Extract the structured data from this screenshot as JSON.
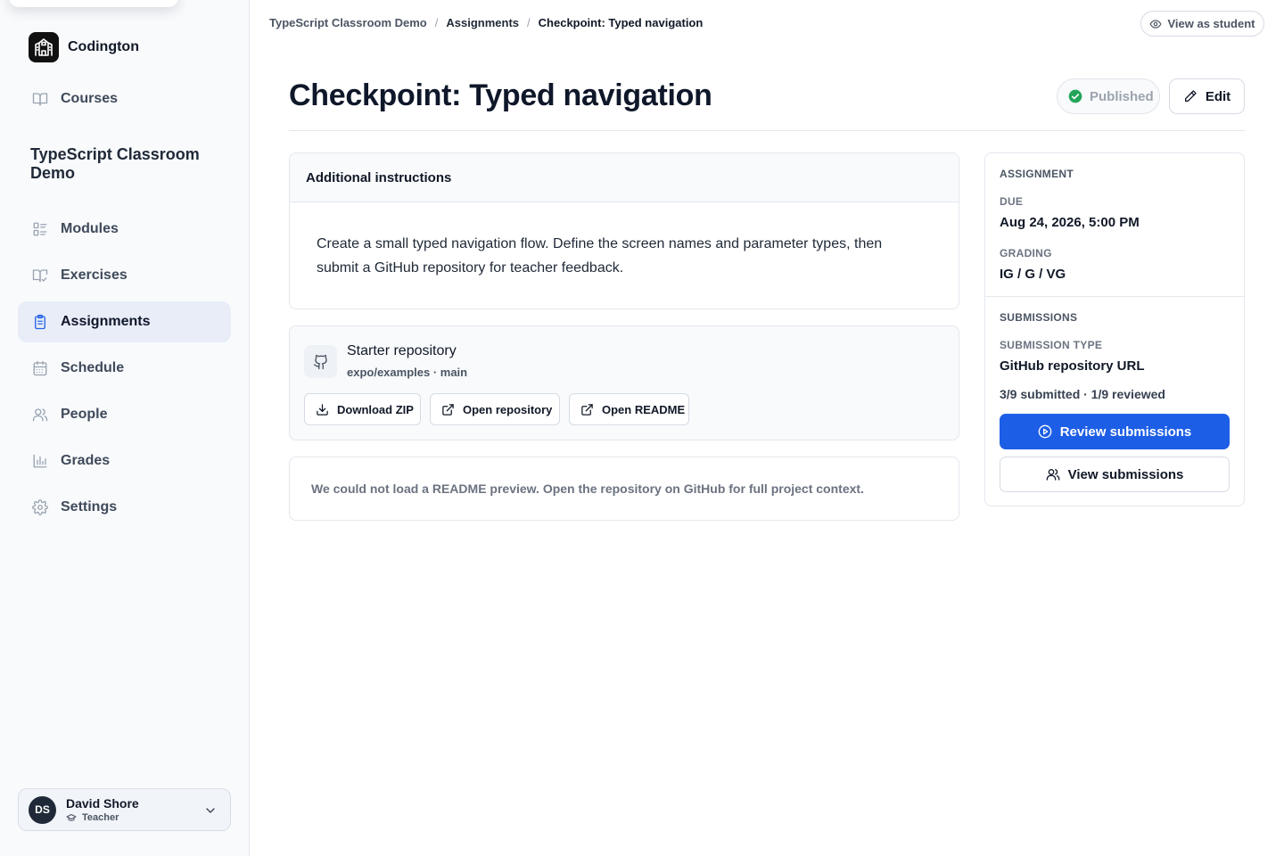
{
  "app": {
    "name": "Codington"
  },
  "sidebar": {
    "top_nav": {
      "label": "Courses",
      "icon": "book-open-icon"
    },
    "course_title": "TypeScript Classroom Demo",
    "items": [
      {
        "label": "Modules",
        "icon": "list-icon",
        "active": false
      },
      {
        "label": "Exercises",
        "icon": "book-check-icon",
        "active": false
      },
      {
        "label": "Assignments",
        "icon": "clipboard-icon",
        "active": true
      },
      {
        "label": "Schedule",
        "icon": "calendar-icon",
        "active": false
      },
      {
        "label": "People",
        "icon": "users-icon",
        "active": false
      },
      {
        "label": "Grades",
        "icon": "bar-chart-icon",
        "active": false
      },
      {
        "label": "Settings",
        "icon": "gear-icon",
        "active": false
      }
    ],
    "user": {
      "initials": "DS",
      "name": "David Shore",
      "role": "Teacher"
    }
  },
  "breadcrumb": [
    "TypeScript Classroom Demo",
    "Assignments",
    "Checkpoint: Typed navigation"
  ],
  "header": {
    "view_as_student": "View as student",
    "title": "Checkpoint: Typed navigation",
    "status": "Published",
    "edit_label": "Edit"
  },
  "instructions": {
    "heading": "Additional instructions",
    "body": "Create a small typed navigation flow. Define the screen names and parameter types, then submit a GitHub repository for teacher feedback."
  },
  "starter": {
    "title": "Starter repository",
    "repo": "expo/examples · main",
    "buttons": {
      "download": "Download ZIP",
      "open_repo": "Open repository",
      "open_readme": "Open README"
    }
  },
  "readme_notice": "We could not load a README preview. Open the repository on GitHub for full project context.",
  "panel": {
    "assignment_heading": "ASSIGNMENT",
    "due_label": "DUE",
    "due_value": "Aug 24, 2026, 5:00 PM",
    "grading_label": "GRADING",
    "grading_value": "IG / G / VG",
    "submissions_heading": "SUBMISSIONS",
    "submission_type_label": "SUBMISSION TYPE",
    "submission_type_value": "GitHub repository URL",
    "counts": "3/9 submitted · 1/9 reviewed",
    "review_button": "Review submissions",
    "view_button": "View submissions"
  },
  "colors": {
    "accent": "#1d5ee6",
    "active_nav_bg": "#e8edf8",
    "published_check": "#22a55a"
  }
}
